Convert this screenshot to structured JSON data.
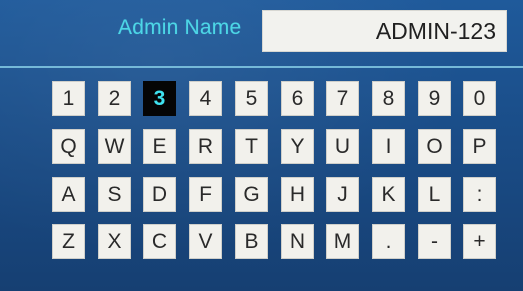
{
  "header": {
    "label": "Admin Name",
    "value": "ADMIN-123"
  },
  "keyboard": {
    "selected_key": "3",
    "rows": [
      [
        "1",
        "2",
        "3",
        "4",
        "5",
        "6",
        "7",
        "8",
        "9",
        "0"
      ],
      [
        "Q",
        "W",
        "E",
        "R",
        "T",
        "Y",
        "U",
        "I",
        "O",
        "P"
      ],
      [
        "A",
        "S",
        "D",
        "F",
        "G",
        "H",
        "J",
        "K",
        "L",
        ":"
      ],
      [
        "Z",
        "X",
        "C",
        "V",
        "B",
        "N",
        "M",
        ".",
        "-",
        "+"
      ]
    ]
  },
  "colors": {
    "background": "#1a4d88",
    "label": "#4dd6e6",
    "divider": "#75b9d8",
    "key_face": "#f2f1ec",
    "selected_key_face": "#050505",
    "selected_key_text": "#3fe2f0"
  }
}
